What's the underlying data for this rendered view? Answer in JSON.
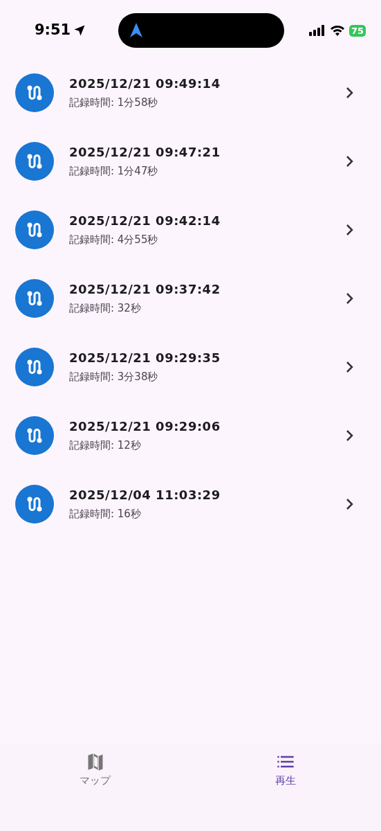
{
  "status_bar": {
    "time": "9:51",
    "battery": "75"
  },
  "recordings": [
    {
      "title": "2025/12/21 09:49:14",
      "subtitle": "記録時間: 1分58秒"
    },
    {
      "title": "2025/12/21 09:47:21",
      "subtitle": "記録時間: 1分47秒"
    },
    {
      "title": "2025/12/21 09:42:14",
      "subtitle": "記録時間: 4分55秒"
    },
    {
      "title": "2025/12/21 09:37:42",
      "subtitle": "記録時間: 32秒"
    },
    {
      "title": "2025/12/21 09:29:35",
      "subtitle": "記録時間: 3分38秒"
    },
    {
      "title": "2025/12/21 09:29:06",
      "subtitle": "記録時間: 12秒"
    },
    {
      "title": "2025/12/04 11:03:29",
      "subtitle": "記録時間: 16秒"
    }
  ],
  "tabs": [
    {
      "kind": "map",
      "label": "マップ",
      "selected": false
    },
    {
      "kind": "list",
      "label": "再生",
      "selected": true
    }
  ]
}
